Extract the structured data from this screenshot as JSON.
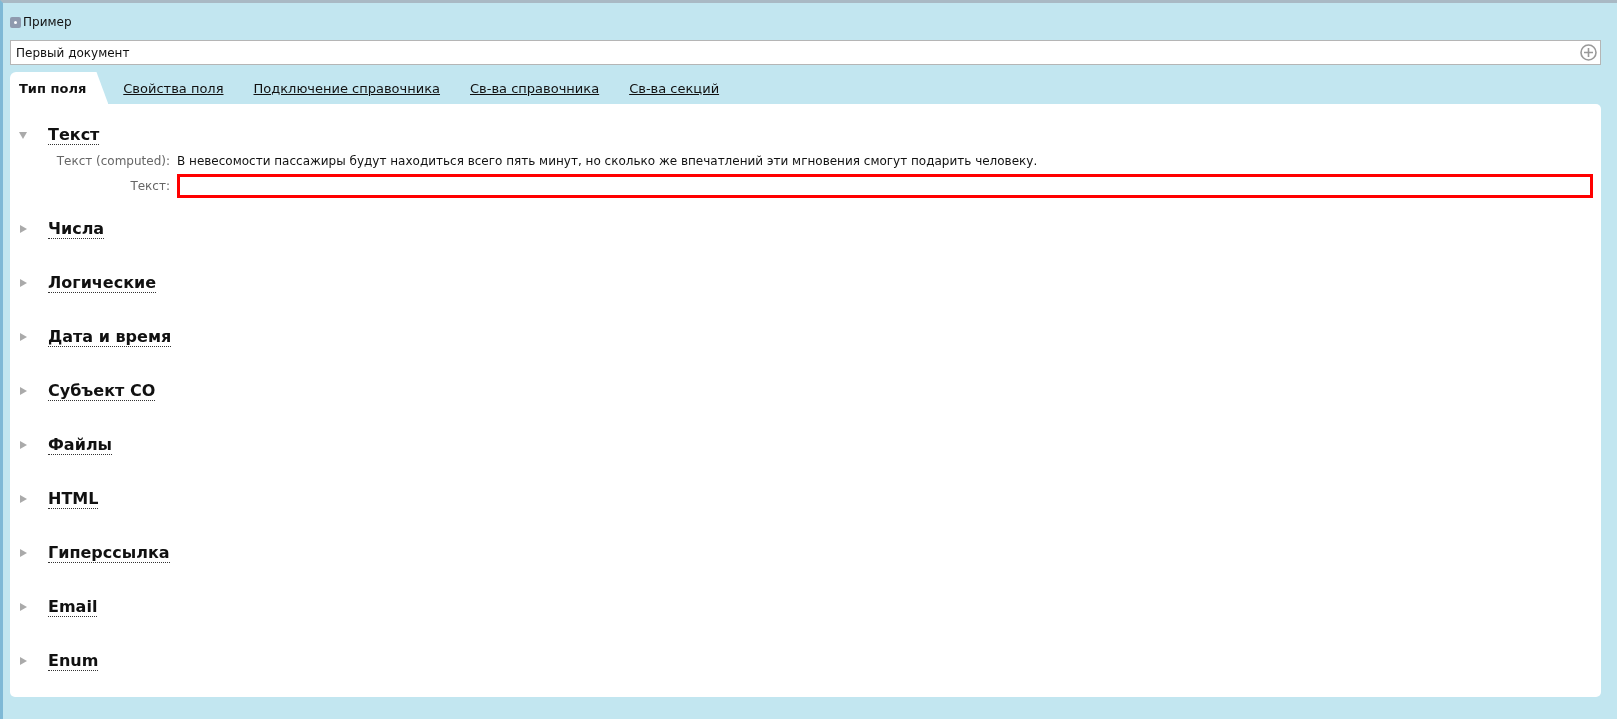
{
  "header": {
    "title": "Пример"
  },
  "document_field": {
    "value": "Первый документ"
  },
  "tabs": [
    {
      "label": "Тип поля",
      "selected": true
    },
    {
      "label": "Свойства поля",
      "selected": false
    },
    {
      "label": "Подключение справочника",
      "selected": false
    },
    {
      "label": "Св-ва справочника",
      "selected": false
    },
    {
      "label": "Св-ва секций",
      "selected": false
    }
  ],
  "sections": [
    {
      "title": "Текст",
      "expanded": true,
      "fields": [
        {
          "kind": "readonly",
          "label": "Текст (computed):",
          "value": "В невесомости пассажиры будут находиться всего пять минут, но сколько же впечатлений эти мгновения смогут подарить человеку."
        },
        {
          "kind": "input",
          "label": "Текст:",
          "error": true
        }
      ]
    },
    {
      "title": "Числа",
      "expanded": false
    },
    {
      "title": "Логические",
      "expanded": false
    },
    {
      "title": "Дата и время",
      "expanded": false
    },
    {
      "title": "Субъект СО",
      "expanded": false
    },
    {
      "title": "Файлы",
      "expanded": false
    },
    {
      "title": "HTML",
      "expanded": false
    },
    {
      "title": "Гиперссылка",
      "expanded": false
    },
    {
      "title": "Email",
      "expanded": false
    },
    {
      "title": "Enum",
      "expanded": false
    }
  ]
}
